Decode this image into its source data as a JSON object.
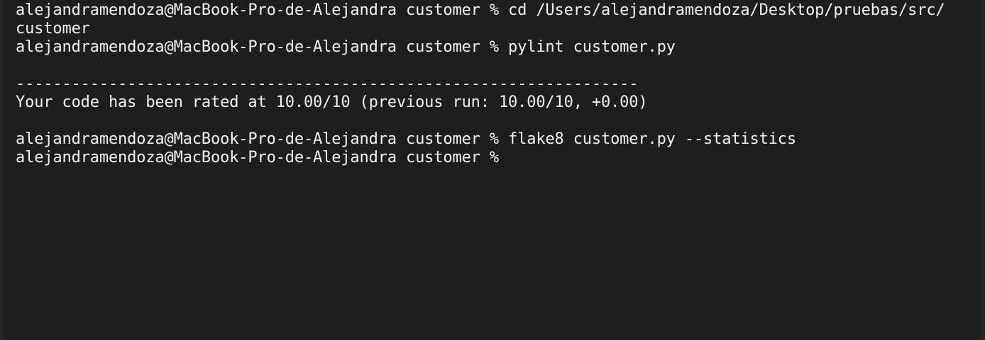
{
  "terminal": {
    "lines": [
      "alejandramendoza@MacBook-Pro-de-Alejandra customer % cd /Users/alejandramendoza/Desktop/pruebas/src/",
      "customer",
      "alejandramendoza@MacBook-Pro-de-Alejandra customer % pylint customer.py",
      "",
      "-------------------------------------------------------------------",
      "Your code has been rated at 10.00/10 (previous run: 10.00/10, +0.00)",
      "",
      "alejandramendoza@MacBook-Pro-de-Alejandra customer % flake8 customer.py --statistics",
      "alejandramendoza@MacBook-Pro-de-Alejandra customer % "
    ]
  }
}
